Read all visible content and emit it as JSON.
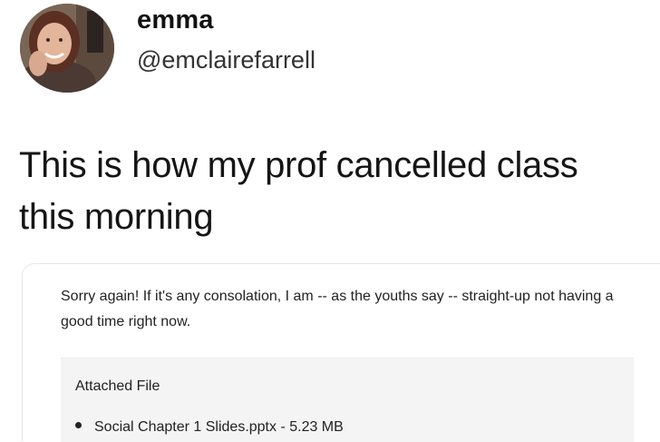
{
  "user": {
    "display_name": "emma",
    "handle": "@emclairefarrell"
  },
  "tweet": {
    "text_line1": "This is how my prof cancelled class",
    "text_line2": "this morning"
  },
  "email": {
    "body": "Sorry again! If it's any consolation, I am -- as the youths say -- straight-up not having a good time right now.",
    "attachment_heading": "Attached File",
    "attachments": [
      {
        "name": "Social Chapter 1 Slides.pptx - 5.23 MB"
      }
    ]
  }
}
